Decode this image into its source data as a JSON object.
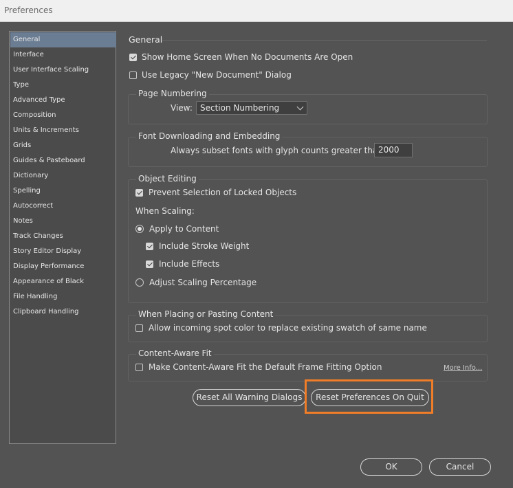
{
  "window": {
    "title": "Preferences"
  },
  "sidebar": {
    "items": [
      {
        "label": "General",
        "active": true
      },
      {
        "label": "Interface"
      },
      {
        "label": "User Interface Scaling"
      },
      {
        "label": "Type"
      },
      {
        "label": "Advanced Type"
      },
      {
        "label": "Composition"
      },
      {
        "label": "Units & Increments"
      },
      {
        "label": "Grids"
      },
      {
        "label": "Guides & Pasteboard"
      },
      {
        "label": "Dictionary"
      },
      {
        "label": "Spelling"
      },
      {
        "label": "Autocorrect"
      },
      {
        "label": "Notes"
      },
      {
        "label": "Track Changes"
      },
      {
        "label": "Story Editor Display"
      },
      {
        "label": "Display Performance"
      },
      {
        "label": "Appearance of Black"
      },
      {
        "label": "File Handling"
      },
      {
        "label": "Clipboard Handling"
      }
    ]
  },
  "general": {
    "heading": "General",
    "show_home_screen": {
      "label": "Show Home Screen When No Documents Are Open",
      "checked": true
    },
    "legacy_new_doc": {
      "label": "Use Legacy \"New Document\" Dialog",
      "checked": false
    }
  },
  "page_numbering": {
    "title": "Page Numbering",
    "view_label": "View:",
    "view_value": "Section Numbering"
  },
  "font_downloading": {
    "title": "Font Downloading and Embedding",
    "subset_label": "Always subset fonts with glyph counts greater than:",
    "subset_value": "2000"
  },
  "object_editing": {
    "title": "Object Editing",
    "prevent_locked": {
      "label": "Prevent Selection of Locked Objects",
      "checked": true
    },
    "when_scaling": "When Scaling:",
    "apply_to_content": {
      "label": "Apply to Content",
      "selected": true
    },
    "include_stroke": {
      "label": "Include Stroke Weight",
      "checked": true
    },
    "include_effects": {
      "label": "Include Effects",
      "checked": true
    },
    "adjust_scaling": {
      "label": "Adjust Scaling Percentage",
      "selected": false
    }
  },
  "placing": {
    "title": "When Placing or Pasting Content",
    "allow_spot": {
      "label": "Allow incoming spot color to replace existing swatch of same name",
      "checked": false
    }
  },
  "content_aware": {
    "title": "Content-Aware Fit",
    "make_default": {
      "label": "Make Content-Aware Fit the Default Frame Fitting Option",
      "checked": false
    },
    "more_info": "More Info..."
  },
  "buttons": {
    "reset_warnings": "Reset All Warning Dialogs",
    "reset_prefs": "Reset Preferences On Quit",
    "ok": "OK",
    "cancel": "Cancel"
  },
  "colors": {
    "highlight": "#f07d27",
    "selected_nav": "#6b7d93",
    "panel_bg": "#535353"
  }
}
